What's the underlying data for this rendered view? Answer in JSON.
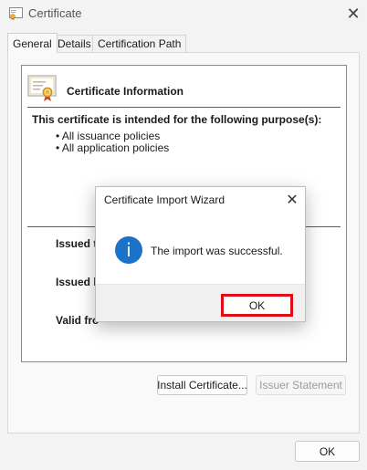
{
  "window": {
    "title": "Certificate",
    "close_glyph": "✕"
  },
  "tabs": [
    {
      "label": "General",
      "active": true
    },
    {
      "label": "Details",
      "active": false
    },
    {
      "label": "Certification Path",
      "active": false
    }
  ],
  "general": {
    "heading": "Certificate Information",
    "purpose_heading": "This certificate is intended for the following purpose(s):",
    "purposes": [
      "All issuance policies",
      "All application policies"
    ],
    "issued_to_label": "Issued t",
    "issued_by_label": "Issued b",
    "valid_from_label": "Valid fro",
    "install_button": "Install Certificate...",
    "issuer_button": "Issuer Statement"
  },
  "footer": {
    "ok_label": "OK"
  },
  "modal": {
    "title": "Certificate Import Wizard",
    "close_glyph": "✕",
    "message": "The import was successful.",
    "info_glyph": "i",
    "ok_label": "OK"
  },
  "icons": {
    "title_icon": "certificate-icon",
    "cert_icon": "certificate-icon",
    "info_icon": "info-icon"
  },
  "colors": {
    "info_blue": "#1a73c9",
    "highlight_red": "#e00d16",
    "seal_gold": "#e8b43c",
    "seal_red": "#d0402b"
  }
}
